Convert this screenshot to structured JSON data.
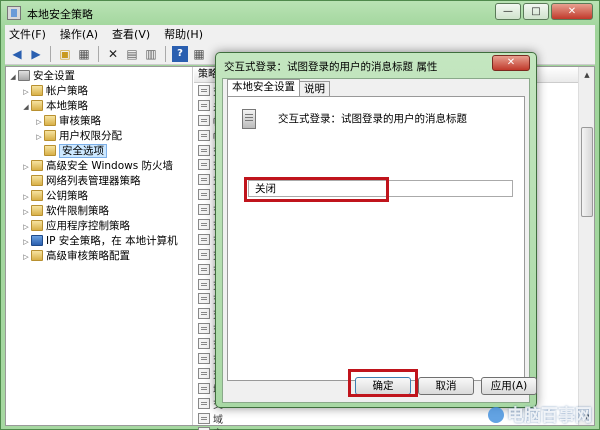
{
  "window": {
    "title": "本地安全策略"
  },
  "menu": [
    "文件(F)",
    "操作(A)",
    "查看(V)",
    "帮助(H)"
  ],
  "tree": [
    {
      "label": "安全设置",
      "indent": 0,
      "arrow": "◢",
      "icon": "root"
    },
    {
      "label": "帐户策略",
      "indent": 1,
      "arrow": "▷",
      "icon": "folder"
    },
    {
      "label": "本地策略",
      "indent": 1,
      "arrow": "◢",
      "icon": "folder"
    },
    {
      "label": "审核策略",
      "indent": 2,
      "arrow": "▷",
      "icon": "folder"
    },
    {
      "label": "用户权限分配",
      "indent": 2,
      "arrow": "▷",
      "icon": "folder"
    },
    {
      "label": "安全选项",
      "indent": 2,
      "arrow": "",
      "icon": "folder",
      "selected": true
    },
    {
      "label": "高级安全 Windows 防火墙",
      "indent": 1,
      "arrow": "▷",
      "icon": "folder"
    },
    {
      "label": "网络列表管理器策略",
      "indent": 1,
      "arrow": "",
      "icon": "folder"
    },
    {
      "label": "公钥策略",
      "indent": 1,
      "arrow": "▷",
      "icon": "folder"
    },
    {
      "label": "软件限制策略",
      "indent": 1,
      "arrow": "▷",
      "icon": "folder"
    },
    {
      "label": "应用程序控制策略",
      "indent": 1,
      "arrow": "▷",
      "icon": "folder"
    },
    {
      "label": "IP 安全策略，在 本地计算机",
      "indent": 1,
      "arrow": "▷",
      "icon": "net"
    },
    {
      "label": "高级审核策略配置",
      "indent": 1,
      "arrow": "▷",
      "icon": "folder"
    }
  ],
  "list": {
    "header": "策略",
    "rows": [
      "交",
      "关",
      "帐",
      "帐",
      "交",
      "交",
      "交",
      "交",
      "交",
      "交",
      "交",
      "交",
      "交",
      "交",
      "交",
      "交",
      "交",
      "交",
      "交",
      "交",
      "域",
      "交",
      "域",
      "交"
    ]
  },
  "dialog": {
    "title": "交互式登录：试图登录的用户的消息标题 属性",
    "close": "✕",
    "tabs": [
      "本地安全设置",
      "说明"
    ],
    "policy_name": "交互式登录：试图登录的用户的消息标题",
    "value": "关闭",
    "ok": "确定",
    "cancel": "取消",
    "apply": "应用(A)"
  },
  "watermark": "电脑百事网",
  "colors": {
    "highlight": "#c0141c",
    "frame": "#a6d8a1"
  },
  "icons": [
    "back-icon",
    "forward-icon",
    "up-icon",
    "show-hide-tree-icon",
    "delete-icon",
    "properties-icon",
    "export-icon",
    "help-icon",
    "view-icon"
  ]
}
